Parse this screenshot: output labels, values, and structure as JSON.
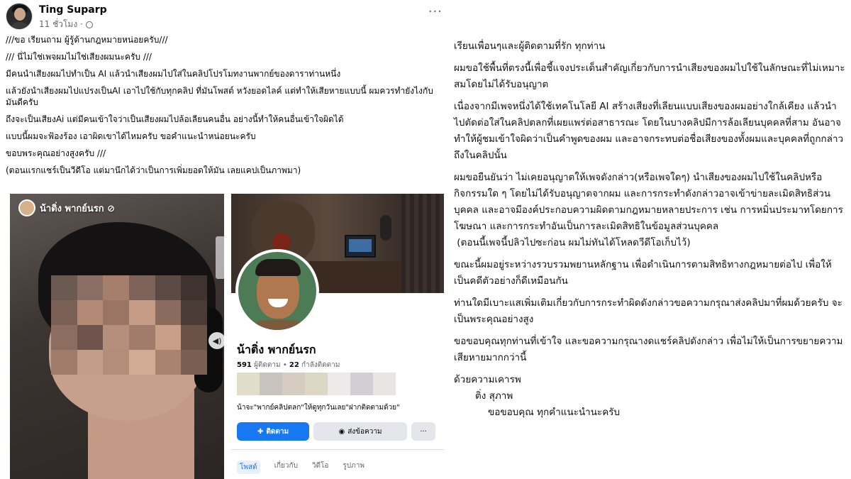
{
  "post": {
    "author": "Ting Suparp",
    "time": "11 ชั่วโมง ·",
    "more": "···",
    "lines": [
      "///ขอ เรียนถาม ผู้รู้ด้านกฎหมายหน่อยครับ///",
      "/// นี่ไม่ใช่เพจผมไม่ใช่เสียงผมนะครับ ///",
      "มีคนนำเสียงผมไปทำเป็น AI แล้วนำเสียงผมไปใส่ในคลิปโปรโมทงานพากย์ของดาราท่านหนึ่ง",
      "แล้วยังนำเสียงผมไปแปรงเป็นAI เอาไปใช้กับทุกคลิป ที่มันโพสต์ หวังยอดไลค์ แต่ทำให้เสียหายแบบนี้ ผมควรทำยังไงกับมันดีครับ",
      "ถึงจะเป็นเสียงAi แต่มีคนเข้าใจว่าเป็นเสียงผมไปล้อเลียนคนอื่น อย่างนี้ทำให้คนอื่นเข้าใจผิดได้",
      "แบบนี้ผมจะฟ้องร้อง เอาผิดเขาได้ไหมครับ ขอคำแนะนำหน่อยนะครับ",
      "ขอบพระคุณอย่างสูงครับ ///",
      "(ตอนแรกแชร์เป็นวีดีโอ แต่มานึกได้ว่าเป็นการเพิ่มยอดให้มัน เลยแคปเป็นภาพมา)"
    ]
  },
  "video_card": {
    "page_name": "น้าติ่ง พากย์นรก ⊘",
    "volume_icon": "speaker-icon"
  },
  "page_card": {
    "name": "น้าติ่ง พากย์นรก",
    "followers_count": "591",
    "followers_label": "ผู้ติดตาม",
    "following_count": "22",
    "following_label": "กำลังติดตาม",
    "bio": "น้าจะ\"พากย์คลิปตลก\"ให้ดูทุกวันเลย\"ฝากติดตามด้วย\"",
    "follow_button": "ติดตาม",
    "message_button": "ส่งข้อความ",
    "more_button": "···",
    "tabs": [
      "โพสต์",
      "เกี่ยวกับ",
      "วิดีโอ",
      "รูปภาพ"
    ]
  },
  "statement": {
    "paragraphs": [
      "เรียนเพื่อนๆและผู้ติดตามที่รัก ทุกท่าน",
      "ผมขอใช้พื้นที่ตรงนี้เพื่อชี้แจงประเด็นสำคัญเกี่ยวกับการนำเสียงของผมไปใช้ในลักษณะที่ไม่เหมาะสมโดยไม่ได้รับอนุญาต",
      "เนื่องจากมีเพจหนึ่งได้ใช้เทคโนโลยี AI สร้างเสียงที่เลียนแบบเสียงของผมอย่างใกล้เคียง แล้วนำไปตัดต่อใส่ในคลิปตลกที่เผยแพร่ต่อสาธารณะ โดยในบางคลิปมีการล้อเลียนบุคคลที่สาม อันอาจทำให้ผู้ชมเข้าใจผิดว่าเป็นคำพูดของผม และอาจกระทบต่อชื่อเสียงของทั้งผมและบุคคลที่ถูกกล่าวถึงในคลิปนั้น",
      "ผมขอยืนยันว่า ไม่เคยอนุญาตให้เพจดังกล่าว(หรือเพจใดๆ) นำเสียงของผมไปใช้ในคลิปหรือกิจกรรมใด ๆ โดยไม่ได้รับอนุญาตจากผม และการกระทำดังกล่าวอาจเข้าข่ายละเมิดสิทธิส่วนบุคคล และอาจมีองค์ประกอบความผิดตามกฎหมายหลายประการ เช่น การหมิ่นประมาทโดยการโฆษณา และการกระทำอันเป็นการละเมิดสิทธิในข้อมูลส่วนบุคคล\n (ตอนนี้เพจนี้ปลิวไปซะก่อน ผมไม่ทันได้โหลดวีดีโอเก็บไว้)",
      "ขณะนี้ผมอยู่ระหว่างรวบรวมพยานหลักฐาน เพื่อดำเนินการตามสิทธิทางกฎหมายต่อไป เพื่อให้เป็นคดีตัวอย่างก็ดีเหมือนกัน",
      "ท่านใดมีเบาะแสเพิ่มเติมเกี่ยวกับการกระทำผิดดังกล่าวขอความกรุณาส่งคลิปมาที่ผมด้วยครับ จะเป็นพระคุณอย่างสูง",
      "ขอขอบคุณทุกท่านที่เข้าใจ และขอความกรุณางดแชร์คลิปดังกล่าว เพื่อไม่ให้เป็นการขยายความเสียหายมากกว่านี้"
    ],
    "closing": "ด้วยความเคารพ",
    "signature": "ติ่ง สุภาพ",
    "thanks": "ขอขอบคุณ ทุกคำแนะนำนะครับ"
  }
}
